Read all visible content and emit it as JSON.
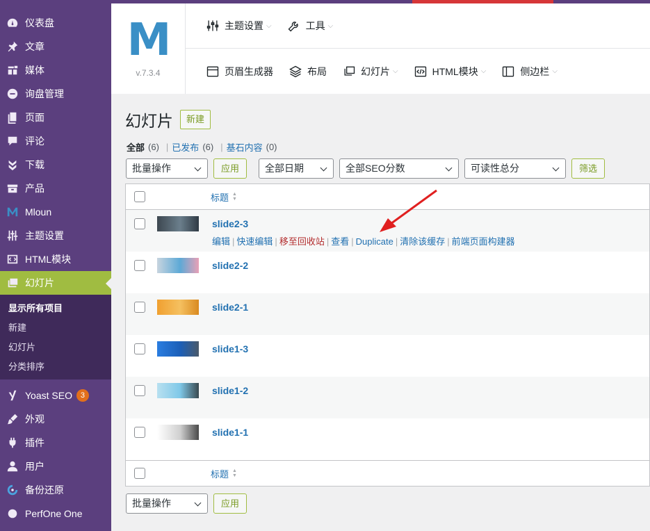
{
  "sidebar": {
    "items": [
      {
        "label": "仪表盘",
        "icon": "dashboard-icon"
      },
      {
        "label": "文章",
        "icon": "pin-icon"
      },
      {
        "label": "媒体",
        "icon": "media-icon"
      },
      {
        "label": "询盘管理",
        "icon": "inquiry-icon"
      },
      {
        "label": "页面",
        "icon": "page-icon"
      },
      {
        "label": "评论",
        "icon": "comment-icon"
      },
      {
        "label": "下载",
        "icon": "download-icon"
      },
      {
        "label": "产品",
        "icon": "product-icon"
      },
      {
        "label": "Mloun",
        "icon": "mloun-logo-icon"
      },
      {
        "label": "主题设置",
        "icon": "sliders-icon"
      },
      {
        "label": "HTML模块",
        "icon": "html-block-icon"
      },
      {
        "label": "幻灯片",
        "icon": "slides-icon"
      }
    ],
    "submenu": [
      "显示所有项目",
      "新建",
      "幻灯片",
      "分类排序"
    ],
    "items_after": [
      {
        "label": "Yoast SEO",
        "icon": "yoast-icon",
        "badge": "3"
      },
      {
        "label": "外观",
        "icon": "brush-icon"
      },
      {
        "label": "插件",
        "icon": "plugin-icon"
      },
      {
        "label": "用户",
        "icon": "user-icon"
      },
      {
        "label": "备份还原",
        "icon": "backup-icon"
      },
      {
        "label": "PerfOne One",
        "icon": "perf-icon"
      }
    ]
  },
  "theme_header": {
    "logo_letter": "M",
    "version": "v.7.3.4",
    "row1": [
      {
        "label": "主题设置",
        "icon": "sliders-icon",
        "dropdown": true
      },
      {
        "label": "工具",
        "icon": "wrench-icon",
        "dropdown": true
      }
    ],
    "row2": [
      {
        "label": "页眉生成器",
        "icon": "header-builder-icon",
        "dropdown": false
      },
      {
        "label": "布局",
        "icon": "layers-icon",
        "dropdown": false
      },
      {
        "label": "幻灯片",
        "icon": "slides-icon",
        "dropdown": true
      },
      {
        "label": "HTML模块",
        "icon": "code-icon",
        "dropdown": true
      },
      {
        "label": "侧边栏",
        "icon": "sidebar-icon",
        "dropdown": true
      }
    ]
  },
  "page": {
    "title": "幻灯片",
    "new_button": "新建",
    "filters": {
      "all": "全部",
      "all_count": "(6)",
      "published": "已发布",
      "published_count": "(6)",
      "cornerstone": "基石内容",
      "cornerstone_count": "(0)"
    },
    "bulk_action": "批量操作",
    "apply": "应用",
    "dates": "全部日期",
    "seo": "全部SEO分数",
    "readability": "可读性总分",
    "filter": "筛选",
    "column_title": "标题"
  },
  "rows": [
    {
      "title": "slide2-3",
      "thumb": [
        "#3d4750",
        "#6b7f8c",
        "#2f3a44"
      ]
    },
    {
      "title": "slide2-2",
      "thumb": [
        "#c7d4df",
        "#5da9d6",
        "#e8a0b6"
      ]
    },
    {
      "title": "slide2-1",
      "thumb": [
        "#f0a030",
        "#f5c060",
        "#d98a20"
      ]
    },
    {
      "title": "slide1-3",
      "thumb": [
        "#2a7de0",
        "#1c5fb8",
        "#4a5a6a"
      ]
    },
    {
      "title": "slide1-2",
      "thumb": [
        "#b8e0f0",
        "#7fc8e8",
        "#3a4a50"
      ]
    },
    {
      "title": "slide1-1",
      "thumb": [
        "#ffffff",
        "#d0d0d0",
        "#4a4a4a"
      ]
    }
  ],
  "row_actions": {
    "edit": "编辑",
    "quick_edit": "快速编辑",
    "trash": "移至回收站",
    "view": "查看",
    "duplicate": "Duplicate",
    "clear_cache": "清除该缓存",
    "builder": "前端页面构建器"
  },
  "colors": {
    "sidebar": "#5b3f7e",
    "active": "#a0bc41",
    "link": "#2271b1",
    "arrow": "#e02020"
  }
}
